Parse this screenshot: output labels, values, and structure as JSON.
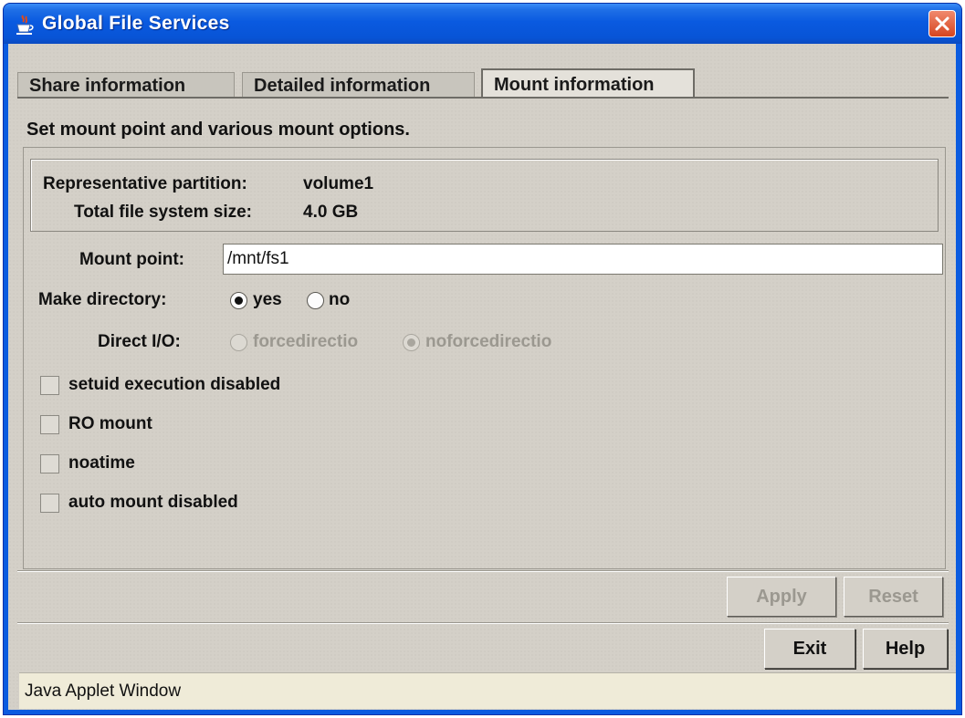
{
  "window": {
    "title": "Global File Services",
    "icon": "java-cup-icon"
  },
  "tabs": [
    {
      "label": "Share information",
      "active": false
    },
    {
      "label": "Detailed information",
      "active": false
    },
    {
      "label": "Mount information",
      "active": true
    }
  ],
  "description": "Set mount point and various mount options.",
  "info": {
    "partition_label": "Representative partition:",
    "partition_value": "volume1",
    "size_label": "Total file system size:",
    "size_value": "4.0 GB"
  },
  "mount_point": {
    "label": "Mount point:",
    "value": "/mnt/fs1"
  },
  "make_directory": {
    "label": "Make directory:",
    "options": [
      "yes",
      "no"
    ],
    "selected": "yes"
  },
  "direct_io": {
    "label": "Direct I/O:",
    "options": [
      "forcedirectio",
      "noforcedirectio"
    ],
    "selected": "noforcedirectio",
    "enabled": false
  },
  "options": [
    {
      "label": "setuid execution disabled",
      "checked": false
    },
    {
      "label": "RO mount",
      "checked": false
    },
    {
      "label": "noatime",
      "checked": false
    },
    {
      "label": "auto mount disabled",
      "checked": false
    }
  ],
  "buttons": {
    "apply": "Apply",
    "reset": "Reset",
    "exit": "Exit",
    "help": "Help"
  },
  "status_bar": "Java Applet Window"
}
